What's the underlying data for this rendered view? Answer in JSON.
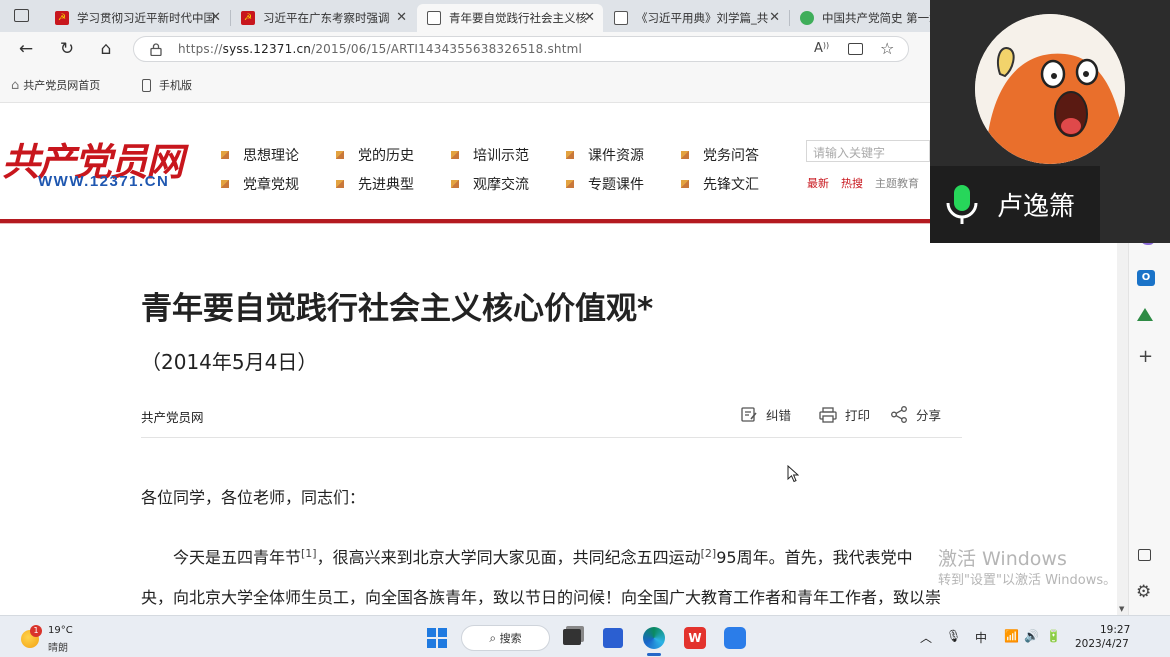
{
  "browser": {
    "tabs": [
      {
        "title": "学习贯彻习近平新时代中国",
        "icon": "party-emblem-icon"
      },
      {
        "title": "习近平在广东考察时强调",
        "icon": "party-emblem-icon"
      },
      {
        "title": "青年要自觉践行社会主义核",
        "icon": "document-icon",
        "active": true
      },
      {
        "title": "《习近平用典》刘学篇_共",
        "icon": "document-icon"
      },
      {
        "title": "中国共产党简史 第一章",
        "icon": "globe-green-icon"
      }
    ],
    "url_prefix": "https://",
    "url_domain": "syss.12371.cn",
    "url_path": "/2015/06/15/ARTI1434355638326518.shtml",
    "favorites": [
      "共产党员网首页",
      "手机版"
    ]
  },
  "site": {
    "logo_text": "共产党员网",
    "logo_url": "WWW.12371.CN",
    "menu_row1": [
      "思想理论",
      "党的历史",
      "培训示范",
      "课件资源",
      "党务问答"
    ],
    "menu_row2": [
      "党章党规",
      "先进典型",
      "观摩交流",
      "专题课件",
      "先锋文汇"
    ],
    "search_placeholder": "请输入关键字",
    "hot_links": [
      "最新",
      "热搜",
      "主题教育"
    ]
  },
  "article": {
    "title": "青年要自觉践行社会主义核心价值观*",
    "date": "（2014年5月4日）",
    "source": "共产党员网",
    "tools": {
      "correct": "纠错",
      "print": "打印",
      "share": "分享"
    },
    "greeting": "各位同学，各位老师，同志们：",
    "p1_a": "今天是五四青年节",
    "p1_sup1": "[1]",
    "p1_b": "，很高兴来到北京大学同大家见面，共同纪念五四运动",
    "p1_sup2": "[2]",
    "p1_c": "95周年。首先，我代表党中",
    "p2": "央，向北京大学全体师生员工，向全国各族青年，致以节日的问候！向全国广大教育工作者和青年工作者，致以崇"
  },
  "watermark": {
    "line1": "激活 Windows",
    "line2": "转到\"设置\"以激活 Windows。"
  },
  "video": {
    "participant": "卢逸箫"
  },
  "taskbar": {
    "weather_temp": "19°C",
    "weather_desc": "晴朗",
    "weather_badge": "1",
    "search_label": "搜索",
    "ime": "中",
    "time": "19:27",
    "date": "2023/4/27"
  }
}
